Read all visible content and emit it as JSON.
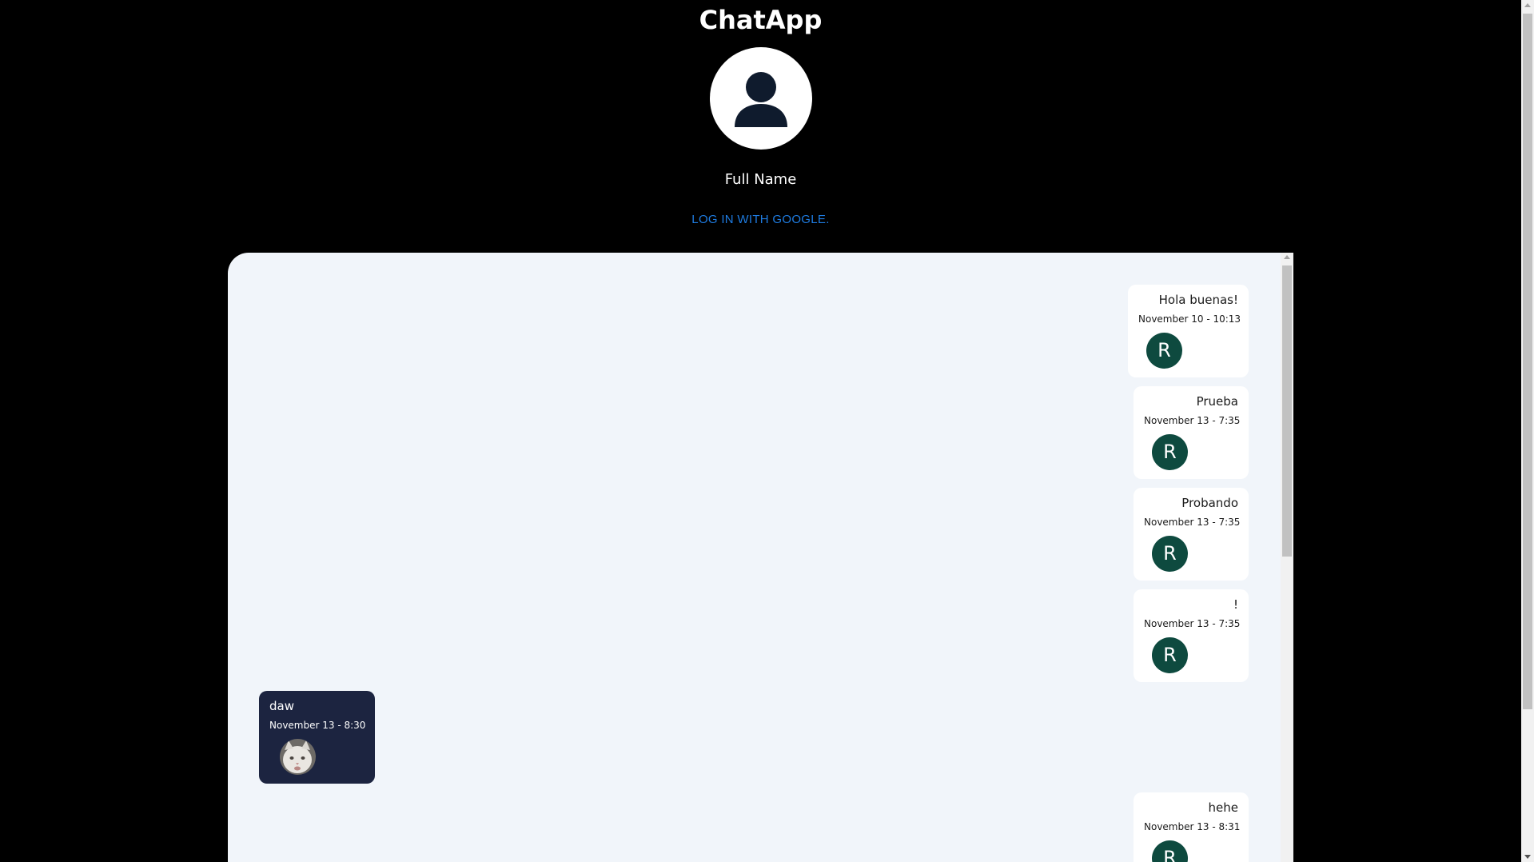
{
  "app": {
    "title": "ChatApp"
  },
  "profile": {
    "avatar_icon": "user-silhouette-icon",
    "full_name": "Full Name",
    "login_link": "LOG IN WITH GOOGLE."
  },
  "colors": {
    "background": "#000000",
    "chat_panel": "#f1f5fa",
    "sent_bubble": "#ffffff",
    "received_bubble": "#1c2440",
    "avatar_letter_bg": "#0e4a3f",
    "link": "#1e7be0"
  },
  "messages": [
    {
      "text": "Hola buenas!",
      "time": "November 10 - 10:13",
      "side": "sent",
      "avatar": "R"
    },
    {
      "text": "Prueba",
      "time": "November 13 - 7:35",
      "side": "sent",
      "avatar": "R"
    },
    {
      "text": "Probando",
      "time": "November 13 - 7:35",
      "side": "sent",
      "avatar": "R"
    },
    {
      "text": "!",
      "time": "November 13 - 7:35",
      "side": "sent",
      "avatar": "R"
    },
    {
      "text": "daw",
      "time": "November 13 - 8:30",
      "side": "received",
      "avatar": "cat-photo"
    },
    {
      "text": "hehe",
      "time": "November 13 - 8:31",
      "side": "sent",
      "avatar": "R"
    }
  ]
}
